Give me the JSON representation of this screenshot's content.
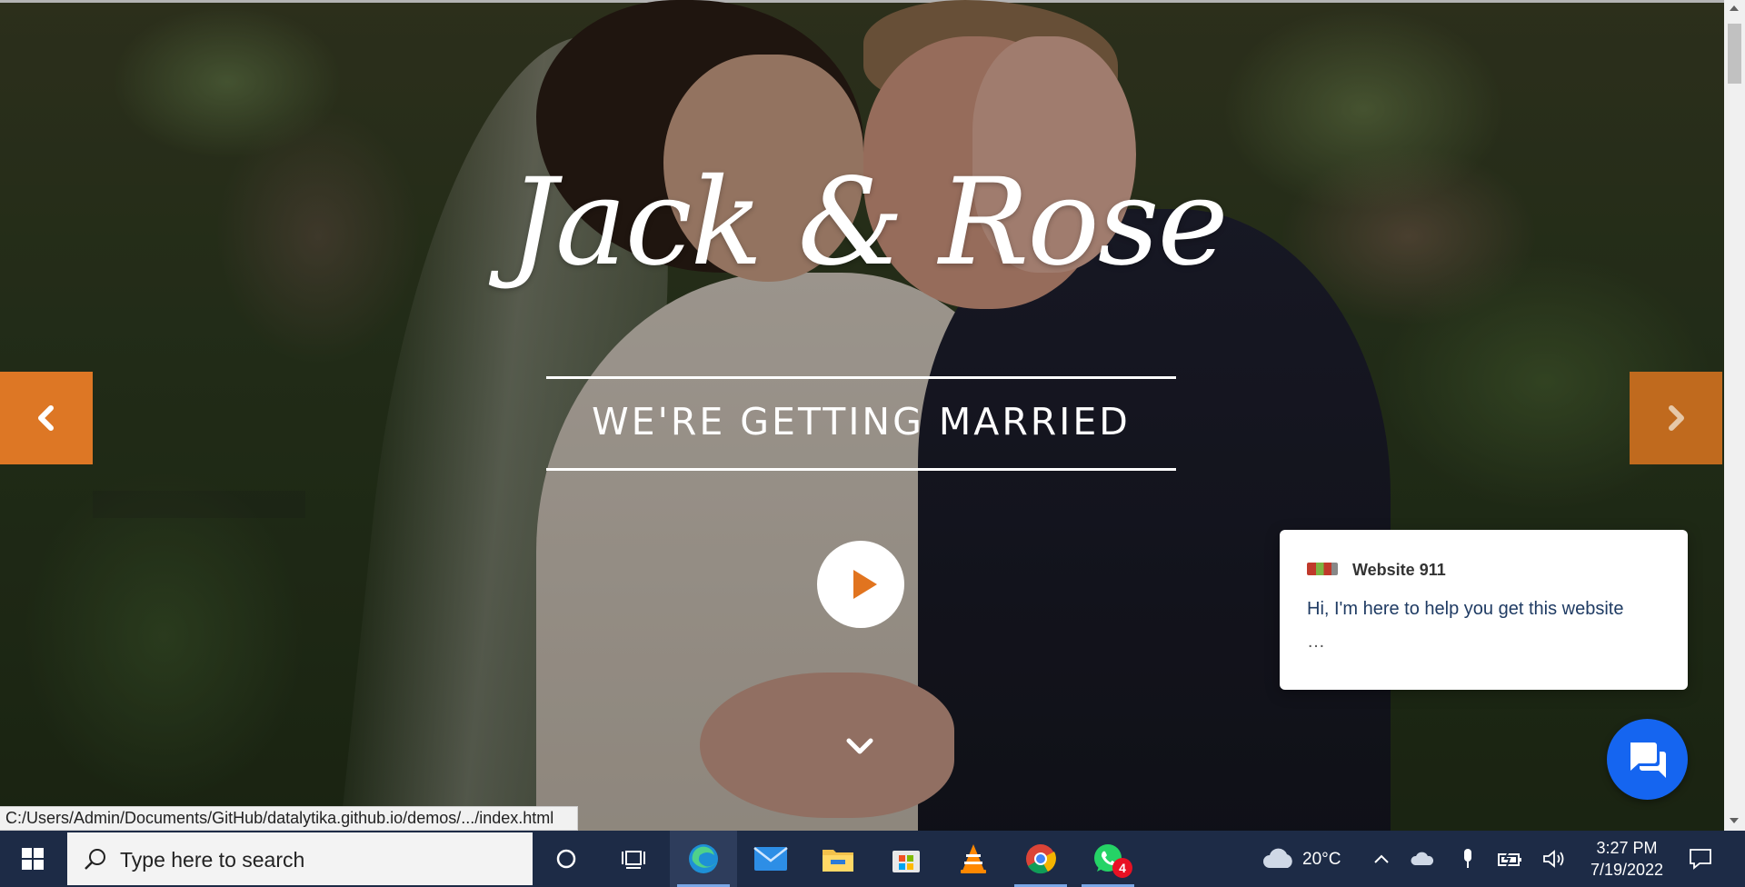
{
  "hero": {
    "title": "Jack & Rose",
    "subtitle": "WE'RE GETTING MARRIED"
  },
  "chat": {
    "agent_name": "Website 911",
    "message": "Hi, I'm here to help you get this website",
    "ellipsis": "…"
  },
  "status_bar": {
    "url": "C:/Users/Admin/Documents/GitHub/datalytika.github.io/demos/.../index.html"
  },
  "taskbar": {
    "search_placeholder": "Type here to search",
    "pinned_apps": [
      "edge-icon",
      "mail-icon",
      "file-explorer-icon",
      "microsoft-store-icon",
      "vlc-icon",
      "chrome-icon",
      "whatsapp-icon"
    ],
    "whatsapp_badge": "4",
    "weather": "20°C",
    "time": "3:27 PM",
    "date": "7/19/2022"
  },
  "colors": {
    "accent_orange": "#dd7725",
    "chat_blue": "#1565f0",
    "taskbar": "#1d2b46"
  }
}
